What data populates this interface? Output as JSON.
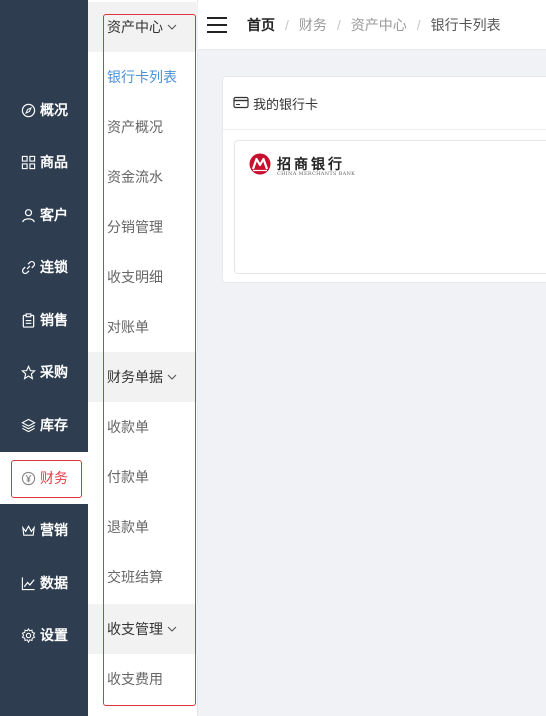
{
  "nav": {
    "items": [
      {
        "label": "概况",
        "icon": "compass-icon"
      },
      {
        "label": "商品",
        "icon": "grid-icon"
      },
      {
        "label": "客户",
        "icon": "user-icon"
      },
      {
        "label": "连锁",
        "icon": "link-icon"
      },
      {
        "label": "销售",
        "icon": "clipboard-icon"
      },
      {
        "label": "采购",
        "icon": "purchase-icon"
      },
      {
        "label": "库存",
        "icon": "layers-icon"
      },
      {
        "label": "财务",
        "icon": "yen-icon",
        "active": true
      },
      {
        "label": "营销",
        "icon": "crown-icon"
      },
      {
        "label": "数据",
        "icon": "chart-icon"
      },
      {
        "label": "设置",
        "icon": "gear-icon"
      }
    ]
  },
  "submenu": {
    "group1": "资产中心",
    "item_bank_list": "银行卡列表",
    "item_asset_overview": "资产概况",
    "item_fund_flow": "资金流水",
    "item_distribution": "分销管理",
    "item_income_detail": "收支明细",
    "item_reconcile": "对账单",
    "group2": "财务单据",
    "item_receipt": "收款单",
    "item_payment": "付款单",
    "item_refund": "退款单",
    "item_shift": "交班结算",
    "group3": "收支管理",
    "item_fees": "收支费用"
  },
  "breadcrumb": {
    "home": "首页",
    "finance": "财务",
    "asset_center": "资产中心",
    "current": "银行卡列表"
  },
  "card": {
    "title": "我的银行卡",
    "bank_name": "招商银行",
    "bank_name_en": "CHINA MERCHANTS BANK"
  },
  "colors": {
    "sidebar": "#2e3e50",
    "accent": "#4a90d9",
    "highlight": "#d9363e"
  }
}
